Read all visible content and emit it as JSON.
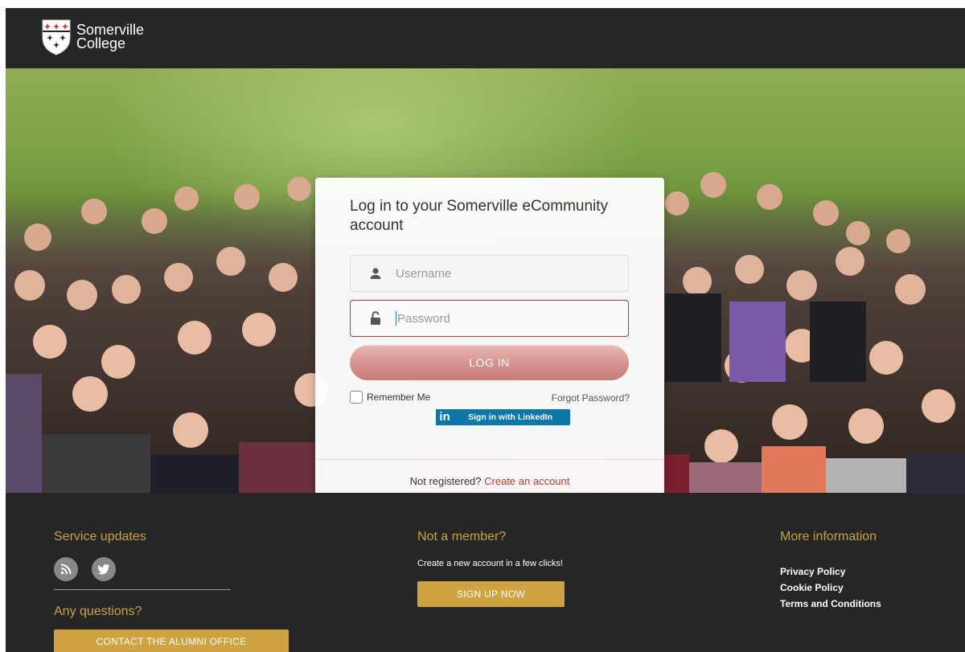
{
  "header": {
    "brand_line1": "Somerville",
    "brand_line2": "College"
  },
  "login": {
    "title": "Log in to your Somerville eCommunity account",
    "username_placeholder": "Username",
    "password_placeholder": "Password",
    "login_label": "LOG IN",
    "remember_label": "Remember Me",
    "forgot_label": "Forgot Password?",
    "linkedin_label": "Sign in with LinkedIn",
    "not_registered": "Not registered?",
    "create_account": "Create an account"
  },
  "footer": {
    "service_updates": "Service updates",
    "any_questions": "Any questions?",
    "contact_label": "CONTACT THE ALUMNI OFFICE",
    "not_member": "Not a member?",
    "new_account_text": "Create a new account in a few clicks!",
    "signup_label": "SIGN UP NOW",
    "more_info": "More information",
    "links": [
      "Privacy Policy",
      "Cookie Policy",
      "Terms and Conditions"
    ],
    "social": [
      "rss-icon",
      "twitter-icon"
    ]
  },
  "colors": {
    "header_bg": "#262626",
    "accent_gold": "#c9a13e",
    "error_red": "#c0392b",
    "login_button": "#d5918c",
    "linkedin_blue": "#0e76a8"
  }
}
